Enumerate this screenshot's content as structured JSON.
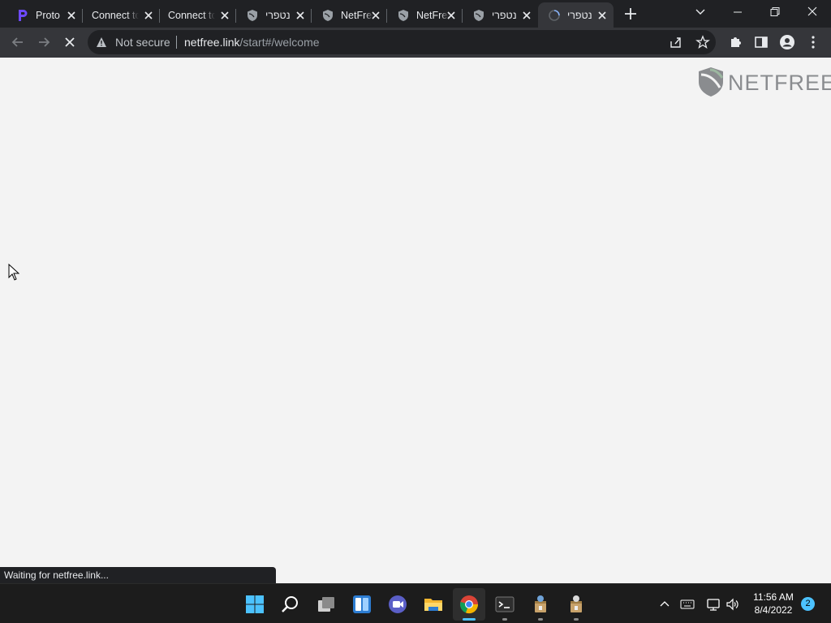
{
  "tabs": [
    {
      "title": "Proto",
      "favicon": "proton-p-icon",
      "has_favicon": true
    },
    {
      "title": "Connect to",
      "favicon": "",
      "has_favicon": false
    },
    {
      "title": "Connect to",
      "favicon": "",
      "has_favicon": false
    },
    {
      "title": "נטפרי",
      "favicon": "netfree-shield-icon",
      "has_favicon": true
    },
    {
      "title": "NetFree",
      "favicon": "netfree-shield-icon",
      "has_favicon": true
    },
    {
      "title": "NetFree",
      "favicon": "netfree-shield-icon",
      "has_favicon": true
    },
    {
      "title": "נטפרי",
      "favicon": "netfree-shield-icon",
      "has_favicon": true
    },
    {
      "title": "נטפרי",
      "favicon": "loading-spinner-icon",
      "has_favicon": true,
      "active": true
    }
  ],
  "toolbar": {
    "security_label": "Not secure",
    "url_host": "netfree.link",
    "url_path": "/start#/welcome"
  },
  "content": {
    "logo_text": "NETFREE"
  },
  "status_bar": {
    "text": "Waiting for netfree.link..."
  },
  "taskbar": {
    "apps": [
      "start-icon",
      "search-icon",
      "task-view-icon",
      "widgets-icon",
      "teams-chat-icon",
      "file-explorer-icon",
      "chrome-icon",
      "terminal-icon",
      "installer-icon",
      "installer-icon"
    ],
    "time": "11:56 AM",
    "date": "8/4/2022",
    "notification_count": "2"
  },
  "colors": {
    "tabbar_bg": "#202124",
    "toolbar_bg": "#35363a",
    "page_bg": "#f3f3f3",
    "accent": "#4cc2ff",
    "proton_purple": "#6d4aff"
  }
}
